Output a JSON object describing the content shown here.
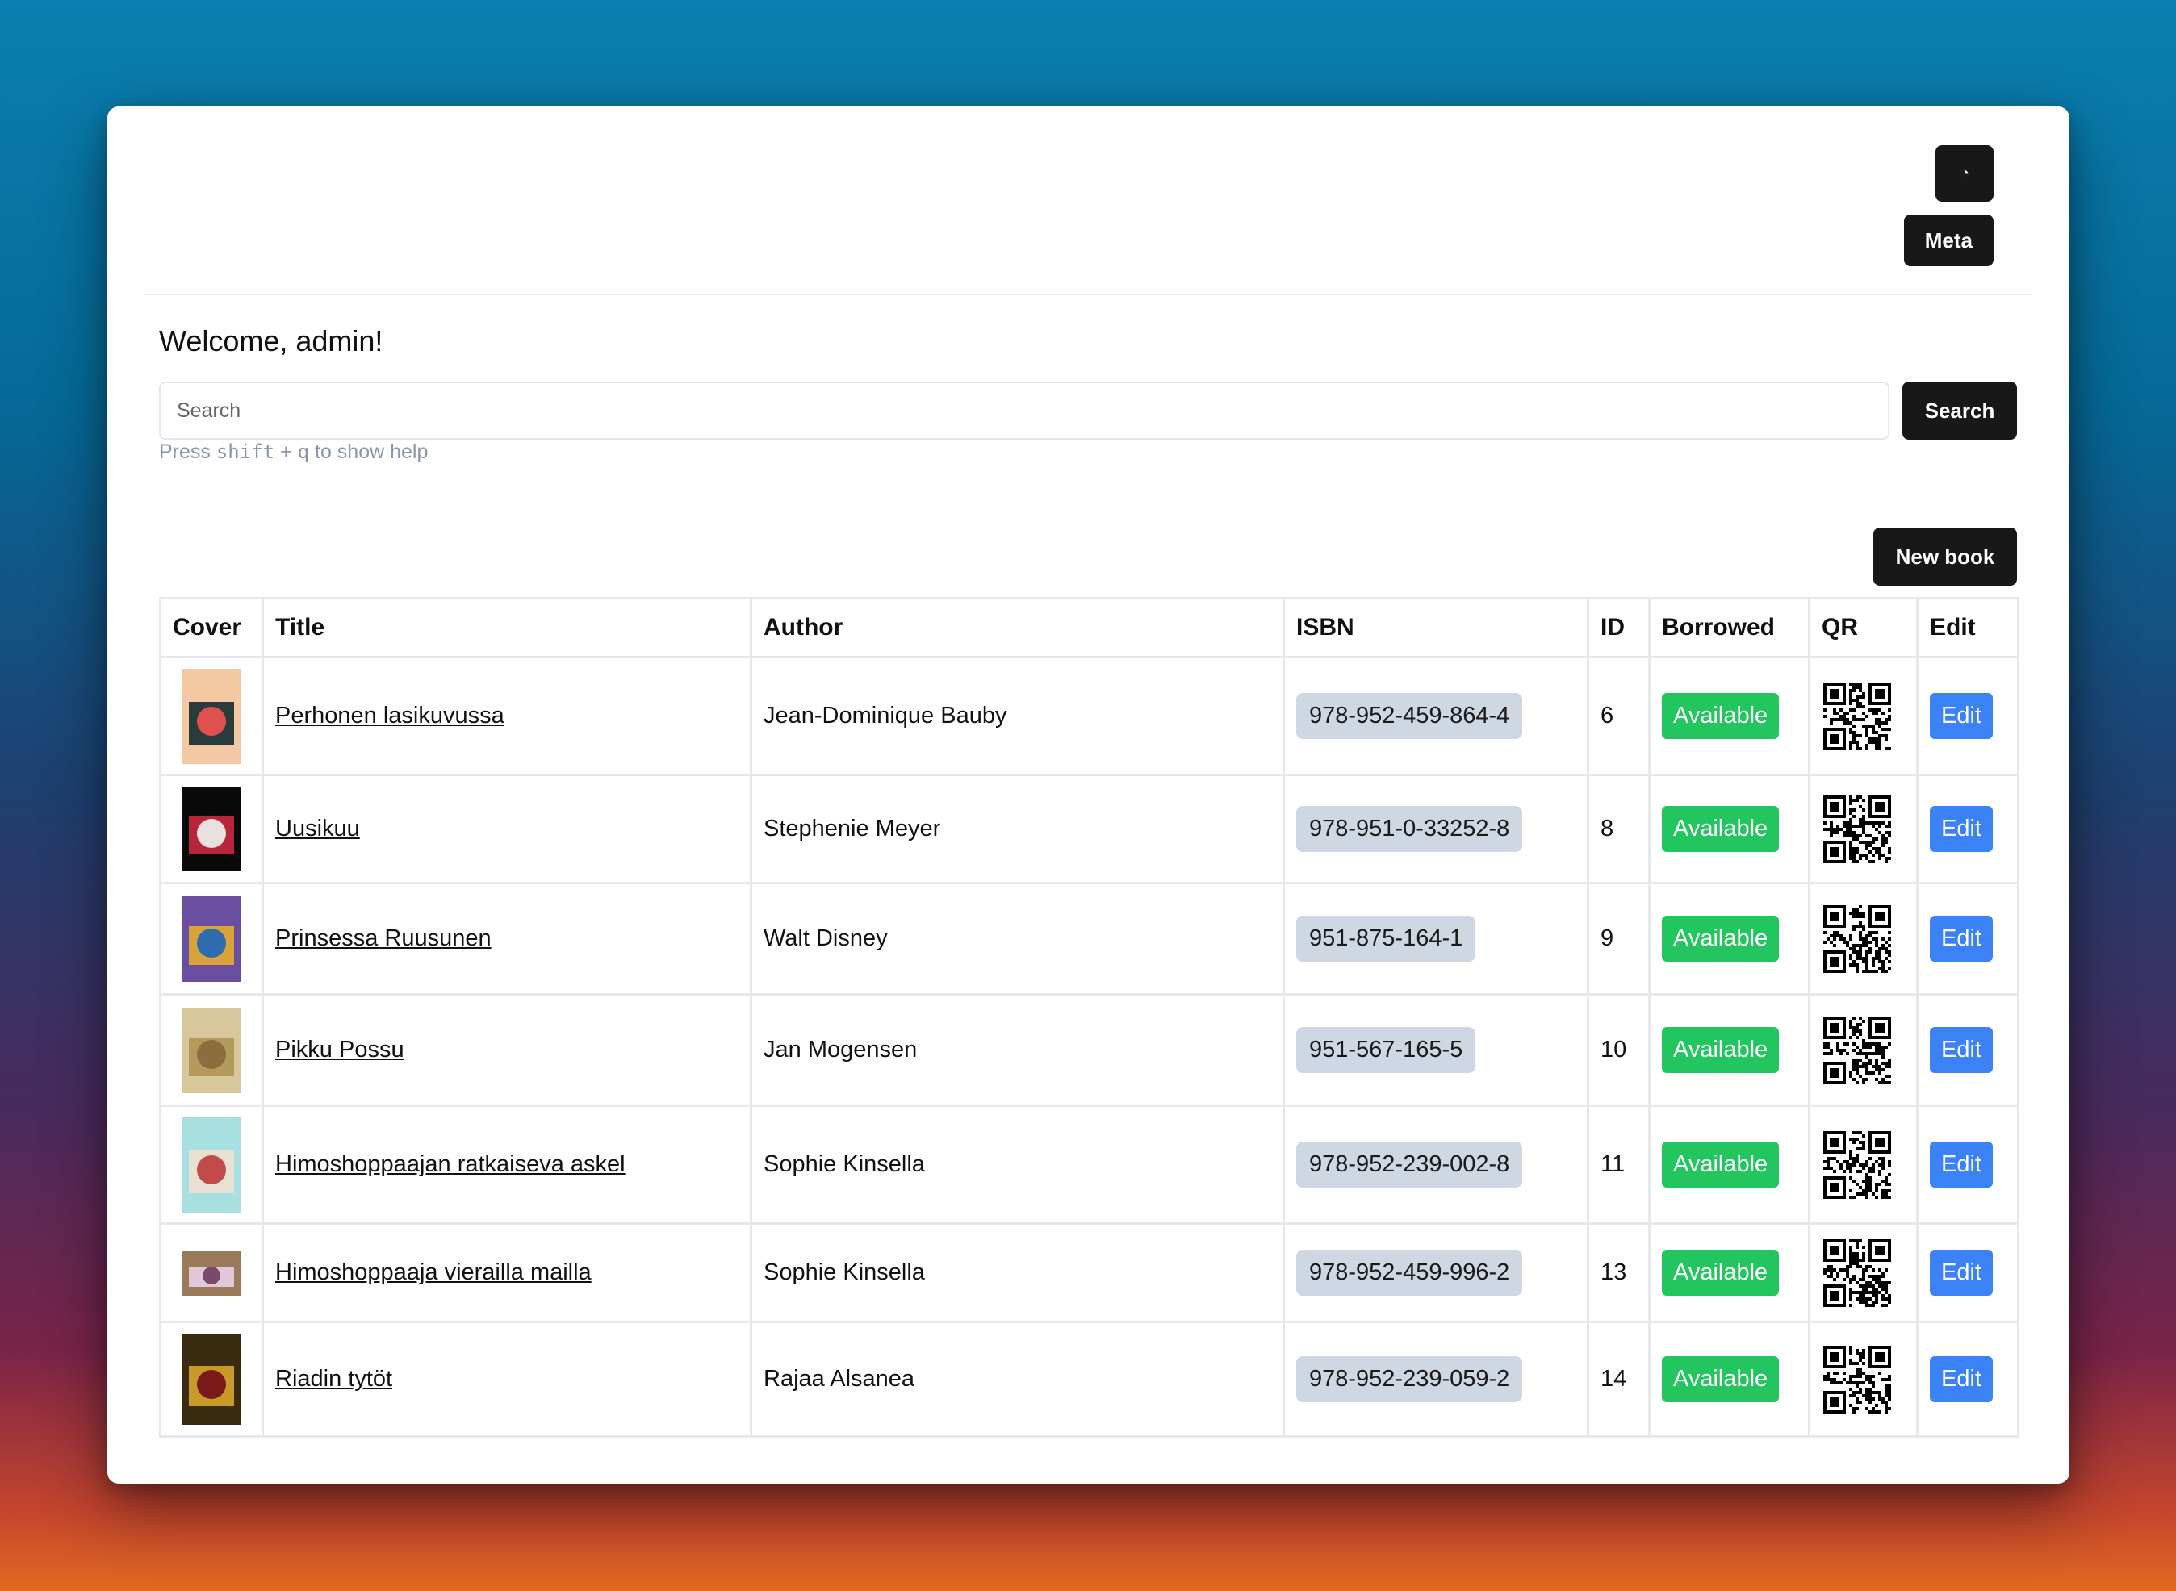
{
  "header": {
    "theme_icon": "moon-icon",
    "theme_glyph": "◔",
    "meta_label": "Meta"
  },
  "welcome": "Welcome, admin!",
  "search": {
    "placeholder": "Search",
    "value": "",
    "button": "Search"
  },
  "hint": {
    "pre": "Press ",
    "key1": "shift",
    "plus": " + ",
    "key2": "q",
    "post": " to show help"
  },
  "new_book_label": "New book",
  "table": {
    "headers": [
      "Cover",
      "Title",
      "Author",
      "ISBN",
      "ID",
      "Borrowed",
      "QR",
      "Edit"
    ],
    "rows": [
      {
        "title": "Perhonen lasikuvussa",
        "author": "Jean-Dominique Bauby",
        "isbn": "978-952-459-864-4",
        "id": "6",
        "status": "Available",
        "edit": "Edit",
        "cover_colors": [
          "#f3c8a2",
          "#2b3a3a",
          "#e05050"
        ]
      },
      {
        "title": "Uusikuu",
        "author": "Stephenie Meyer",
        "isbn": "978-951-0-33252-8",
        "id": "8",
        "status": "Available",
        "edit": "Edit",
        "cover_colors": [
          "#0a0a0a",
          "#b8243a",
          "#e9e0e0"
        ]
      },
      {
        "title": "Prinsessa Ruusunen",
        "author": "Walt Disney",
        "isbn": "951-875-164-1",
        "id": "9",
        "status": "Available",
        "edit": "Edit",
        "cover_colors": [
          "#6a4fa0",
          "#d9a23a",
          "#2e6cb0"
        ]
      },
      {
        "title": "Pikku Possu",
        "author": "Jan Mogensen",
        "isbn": "951-567-165-5",
        "id": "10",
        "status": "Available",
        "edit": "Edit",
        "cover_colors": [
          "#d8c79a",
          "#b59a5e",
          "#8c6d3e"
        ]
      },
      {
        "title": "Himoshoppaajan ratkaiseva askel",
        "author": "Sophie Kinsella",
        "isbn": "978-952-239-002-8",
        "id": "11",
        "status": "Available",
        "edit": "Edit",
        "cover_colors": [
          "#a8dfe0",
          "#e8e0d0",
          "#c24a4a"
        ]
      },
      {
        "title": "Himoshoppaaja vieraill​a mailla",
        "author": "Sophie Kinsella",
        "isbn": "978-952-459-996-2",
        "id": "13",
        "status": "Available",
        "edit": "Edit",
        "cover_colors": [
          "#9a7a5a",
          "#e0c8d8",
          "#7a4a6a"
        ]
      },
      {
        "title": "Riadin tytöt",
        "author": "Rajaa Alsanea",
        "isbn": "978-952-239-059-2",
        "id": "14",
        "status": "Available",
        "edit": "Edit",
        "cover_colors": [
          "#3a2a10",
          "#c89a2a",
          "#7a1a1a"
        ]
      }
    ]
  }
}
